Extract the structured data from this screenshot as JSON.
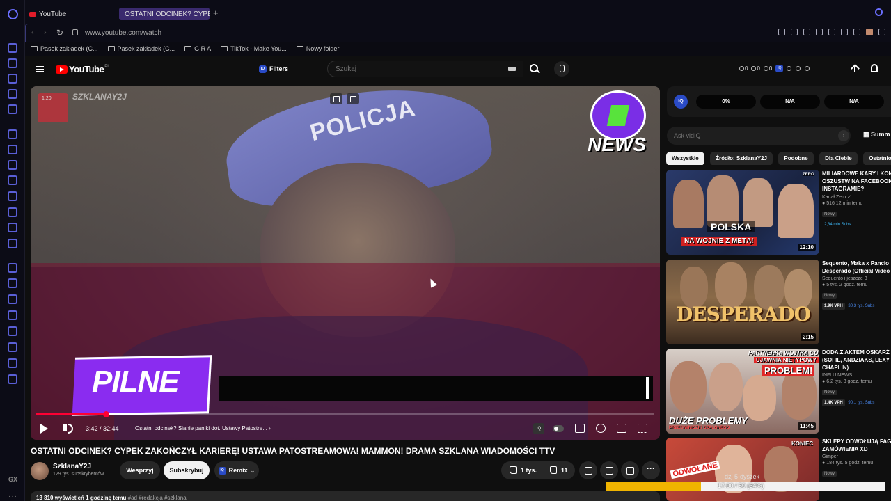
{
  "browser": {
    "tabs": [
      {
        "label": "YouTube"
      },
      {
        "label": "OSTATNI ODCINEK? CYPE"
      }
    ],
    "url": "www.youtube.com/watch",
    "bookmarks": [
      {
        "label": "Pasek zakładek (C..."
      },
      {
        "label": "Pasek zakładek (C..."
      },
      {
        "label": "G R A"
      },
      {
        "label": "TikTok - Make You..."
      },
      {
        "label": "Nowy folder"
      }
    ],
    "profile_letter": "D",
    "sidebar_mark": "GX"
  },
  "header": {
    "logo_text": "YouTube",
    "logo_region": "PL",
    "filters_label": "Filters",
    "iq_label": "IQ",
    "search_placeholder": "Szukaj",
    "counters": [
      "0",
      "0",
      "0"
    ]
  },
  "player": {
    "watermark_number": "1.20",
    "watermark_text": "SZKLANAY2J",
    "cap_text": "POLICJA",
    "news_label": "NEWS",
    "pilne_label": "PILNE",
    "time_label": "3:42 / 32:44",
    "progress_fraction": 0.1131,
    "buffer_fraction": 0.15,
    "chapter_label": "Ostatni odcinek? Sianie paniki dot. Ustawy Patostre..."
  },
  "video": {
    "title": "OSTATNI ODCINEK? CYPEK ZAKOŃCZYŁ KARIERĘ! USTAWA PATOSTREAMOWA! MAMMON! DRAMA SZKLANA WIADOMOŚCI TTV",
    "channel_name": "SzklanaY2J",
    "channel_subs": "129 tys. subskrybentów",
    "support_label": "Wesprzyj",
    "subscribe_label": "Subskrybuj",
    "remix_label": "Remix",
    "likes_label": "1 tys.",
    "dislikes_label": "11",
    "description_views": "13 810 wyświetleń  1 godzinę temu",
    "description_tags": "#ad #redakcja #szklana"
  },
  "vidiq": {
    "stats": [
      "0%",
      "N/A",
      "N/A"
    ],
    "ask_placeholder": "Ask vidIQ",
    "summ_label": "Summ"
  },
  "chips": [
    "Wszystkie",
    "Źródło: SzklanaY2J",
    "Podobne",
    "Dla Ciebie",
    "Ostatnio p"
  ],
  "recommendations": [
    {
      "title": "MILIARDOWE KARY I KON",
      "title2": "OSZUSTW NA FACEBOOK",
      "title3": "INSTAGRAMIE?",
      "channel": "Kanał Zero",
      "meta": "516  12 min temu",
      "badge": "Nowy",
      "vph": "",
      "subs": "2,34 mln Subs",
      "duration": "12:10",
      "caption_top": "POLSKA",
      "caption_bottom": "NA WOJNIE Z METĄ!",
      "caption_brand": "ZERO"
    },
    {
      "title": "Sequento, Maka x Pancio",
      "title2": "Desperado (Official Video",
      "title3": "",
      "channel": "Sequento   i jeszcze 3",
      "meta": "5 tys.  2 godz. temu",
      "badge": "Nowy",
      "vph": "1.9K VPH",
      "subs": "30,3 tys. Subs",
      "duration": "2:15",
      "caption_top": "DESPERADO",
      "caption_bottom": "",
      "caption_brand": ""
    },
    {
      "title": "DODA Z AKTEM OSKARŻ",
      "title2": "(SOFIL, ANDZIAKS, LEXY",
      "title3": "CHAPLIN)",
      "channel": "INFLU NEWS",
      "meta": "6,2 tys.  3 godz. temu",
      "badge": "Nowy",
      "vph": "1.4K VPH",
      "subs": "90,1 tys. Subs",
      "duration": "11:45",
      "caption_top": "PARTNERKA WOJTKA GOL",
      "caption_bottom": "UJAWNIA NIETYPOWY",
      "caption_brand": "PROBLEM!",
      "caption_extra": "DUŻE PROBLEMY",
      "caption_extra2": "PRZECIWNICZKI SZALONEGO"
    },
    {
      "title": "SKLEPY ODWOŁUJĄ FAG",
      "title2": "ZAMÓWIENIA XD",
      "title3": "",
      "channel": "Gimper",
      "meta": "184 tys.  5 godz. temu",
      "badge": "Nowy",
      "vph": "",
      "subs": "",
      "duration": "",
      "caption_top": "KONIEC",
      "caption_bottom": "ODWOŁANE",
      "caption_brand": ""
    }
  ],
  "download_overlay": {
    "label": "dzj 5-dyszek",
    "text": "17.00 / 50 (34%)",
    "fraction": 0.34
  }
}
